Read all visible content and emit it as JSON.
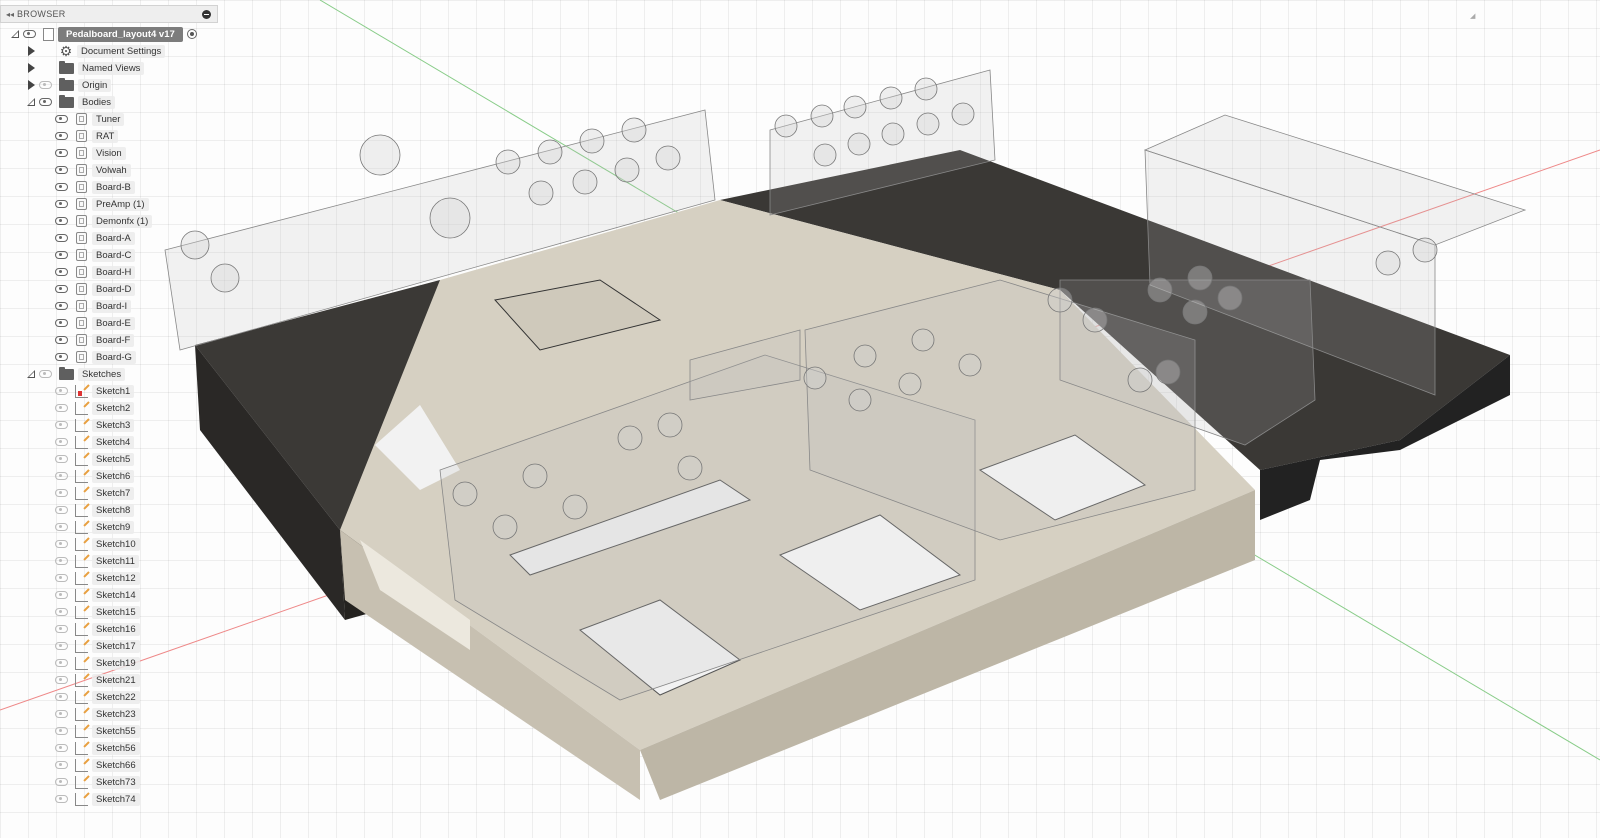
{
  "browser": {
    "title": "BROWSER",
    "root": {
      "label": "Pedalboard_layout4 v17"
    },
    "nodes": [
      {
        "label": "Document Settings",
        "icon": "gear-icon"
      },
      {
        "label": "Named Views",
        "icon": "folder-icon"
      },
      {
        "label": "Origin",
        "icon": "folder-icon"
      },
      {
        "label": "Bodies",
        "icon": "folder-icon"
      }
    ],
    "bodies": [
      "Tuner",
      "RAT",
      "Vision",
      "Volwah",
      "Board-B",
      "PreAmp (1)",
      "Demonfx (1)",
      "Board-A",
      "Board-C",
      "Board-H",
      "Board-D",
      "Board-I",
      "Board-E",
      "Board-F",
      "Board-G"
    ],
    "sketches_folder": {
      "label": "Sketches"
    },
    "sketches": [
      "Sketch1",
      "Sketch2",
      "Sketch3",
      "Sketch4",
      "Sketch5",
      "Sketch6",
      "Sketch7",
      "Sketch8",
      "Sketch9",
      "Sketch10",
      "Sketch11",
      "Sketch12",
      "Sketch14",
      "Sketch15",
      "Sketch16",
      "Sketch17",
      "Sketch19",
      "Sketch21",
      "Sketch22",
      "Sketch23",
      "Sketch55",
      "Sketch56",
      "Sketch66",
      "Sketch73",
      "Sketch74"
    ]
  },
  "colors": {
    "dark_board": "#3a3835",
    "light_board": "#d8d2c4",
    "ghost": "rgba(200,200,200,0.25)",
    "axis_red": "#e06060",
    "axis_green": "#60c060"
  }
}
